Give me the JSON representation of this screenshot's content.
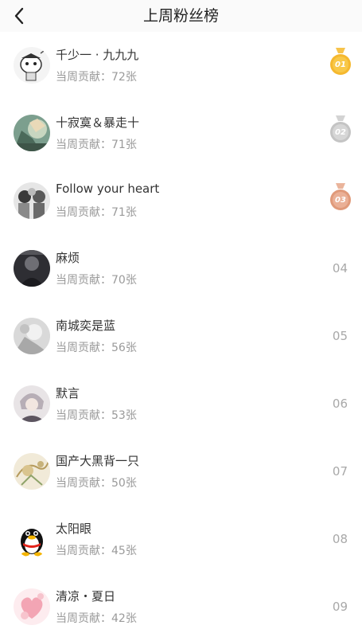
{
  "header": {
    "title": "上周粉丝榜",
    "back_icon": "chevron-left-icon"
  },
  "contrib_prefix": "当周贡献：",
  "fans": [
    {
      "name": "千少一 · 九九九",
      "contribution": "当周贡献：72张",
      "rank": "01",
      "medal": "gold"
    },
    {
      "name": "十寂寞＆暴走十",
      "contribution": "当周贡献：71张",
      "rank": "02",
      "medal": "silver"
    },
    {
      "name": "Follow your heart",
      "contribution": "当周贡献：71张",
      "rank": "03",
      "medal": "bronze"
    },
    {
      "name": "麻烦",
      "contribution": "当周贡献：70张",
      "rank": "04"
    },
    {
      "name": "南城奕是蓝",
      "contribution": "当周贡献：56张",
      "rank": "05"
    },
    {
      "name": "默言",
      "contribution": "当周贡献：53张",
      "rank": "06"
    },
    {
      "name": "国产大黑背一只",
      "contribution": "当周贡献：50张",
      "rank": "07"
    },
    {
      "name": "太阳眼",
      "contribution": "当周贡献：45张",
      "rank": "08"
    },
    {
      "name": "清凉・夏日",
      "contribution": "当周贡献：42张",
      "rank": "09"
    }
  ],
  "colors": {
    "gold": "#f5b82e",
    "silver": "#c9c9c9",
    "bronze": "#e6a98c",
    "rank_text": "#a8a8a8"
  }
}
